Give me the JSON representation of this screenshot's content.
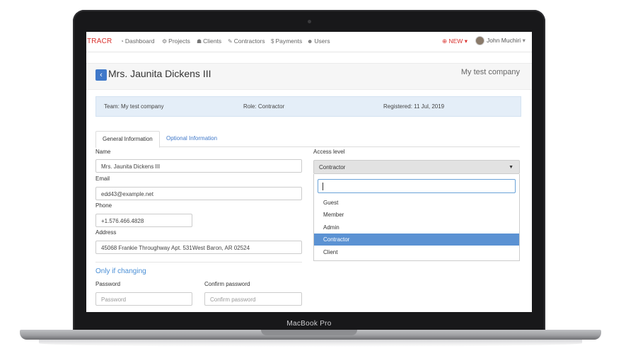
{
  "navbar": {
    "brand": "TRACR",
    "items": [
      {
        "label": "Dashboard",
        "icon": "dashboard-icon"
      },
      {
        "label": "Projects",
        "icon": "cogs-icon"
      },
      {
        "label": "Clients",
        "icon": "users-icon"
      },
      {
        "label": "Contractors",
        "icon": "wrench-icon"
      },
      {
        "label": "Payments",
        "icon": "dollar-icon"
      },
      {
        "label": "Users",
        "icon": "user-icon"
      }
    ],
    "new_label": "NEW",
    "user_name": "John Muchiri"
  },
  "page": {
    "title": "Mrs. Jaunita Dickens III",
    "company": "My test company"
  },
  "info": {
    "team": "Team: My test company",
    "role": "Role: Contractor",
    "registered": "Registered: 11 Jul, 2019"
  },
  "tabs": {
    "general": "General Information",
    "optional": "Optional Information"
  },
  "form": {
    "name_label": "Name",
    "name_value": "Mrs. Jaunita Dickens III",
    "email_label": "Email",
    "email_value": "edd43@example.net",
    "phone_label": "Phone",
    "phone_value": "+1.576.466.4828",
    "address_label": "Address",
    "address_value": "45068 Frankie Throughway Apt. 531West Baron, AR 02524",
    "access_label": "Access level",
    "access_value": "Contractor",
    "access_options": [
      "Guest",
      "Member",
      "Admin",
      "Contractor",
      "Client"
    ],
    "section_title": "Only if changing",
    "password_label": "Password",
    "password_placeholder": "Password",
    "confirm_label": "Confirm password",
    "confirm_placeholder": "Confirm password"
  },
  "device_label": "MacBook Pro",
  "colors": {
    "brand": "#d9332f",
    "accent": "#3f78c9",
    "selected_option": "#5b92d3",
    "info_bar": "#e4eef8"
  }
}
